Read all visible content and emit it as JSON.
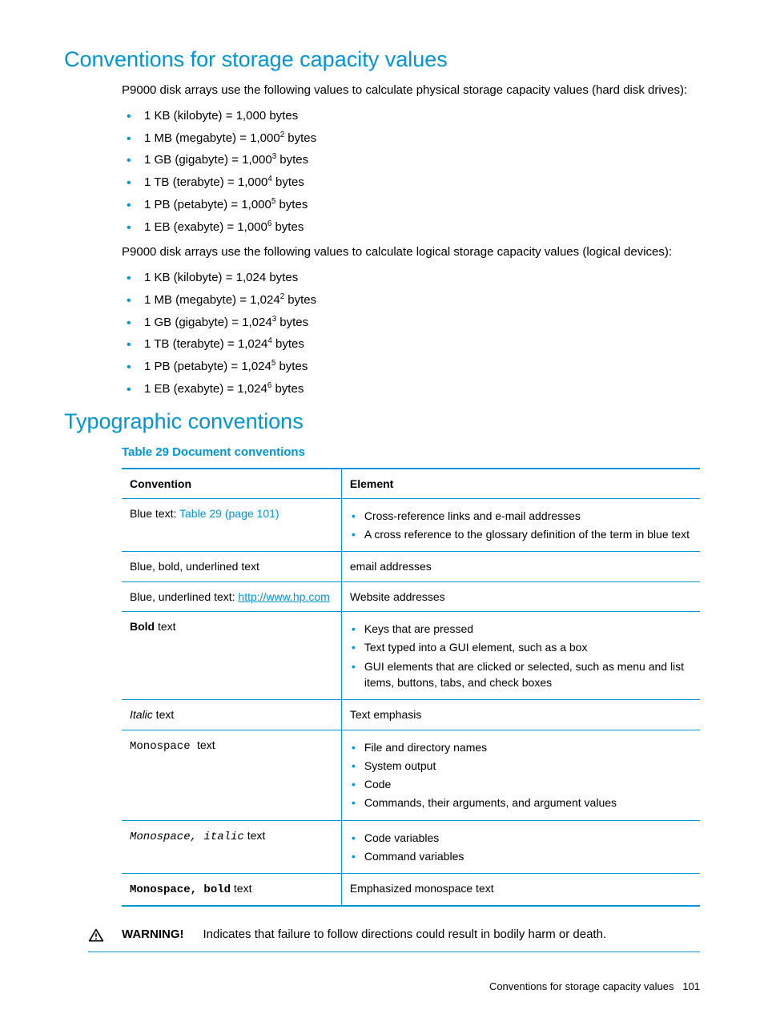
{
  "sections": {
    "storage": {
      "title": "Conventions for storage capacity values",
      "intro_physical": "P9000 disk arrays use the following values to calculate physical storage capacity values (hard disk drives):",
      "physical": [
        {
          "text": "1 KB (kilobyte) = 1,000 bytes",
          "exp": ""
        },
        {
          "text": "1 MB (megabyte) = 1,000",
          "exp": "2",
          "suffix": " bytes"
        },
        {
          "text": "1 GB (gigabyte) = 1,000",
          "exp": "3",
          "suffix": " bytes"
        },
        {
          "text": "1 TB (terabyte) = 1,000",
          "exp": "4",
          "suffix": " bytes"
        },
        {
          "text": "1 PB (petabyte) = 1,000",
          "exp": "5",
          "suffix": " bytes"
        },
        {
          "text": "1 EB (exabyte) = 1,000",
          "exp": "6",
          "suffix": " bytes"
        }
      ],
      "intro_logical": "P9000 disk arrays use the following values to calculate logical storage capacity values (logical devices):",
      "logical": [
        {
          "text": "1 KB (kilobyte) = 1,024 bytes",
          "exp": ""
        },
        {
          "text": "1 MB (megabyte) = 1,024",
          "exp": "2",
          "suffix": " bytes"
        },
        {
          "text": "1 GB (gigabyte) = 1,024",
          "exp": "3",
          "suffix": " bytes"
        },
        {
          "text": "1 TB (terabyte) = 1,024",
          "exp": "4",
          "suffix": " bytes"
        },
        {
          "text": "1 PB (petabyte) = 1,024",
          "exp": "5",
          "suffix": " bytes"
        },
        {
          "text": "1 EB (exabyte) = 1,024",
          "exp": "6",
          "suffix": " bytes"
        }
      ]
    },
    "typo": {
      "title": "Typographic conventions",
      "table_caption": "Table 29 Document conventions",
      "headers": {
        "c1": "Convention",
        "c2": "Element"
      },
      "rows": {
        "r1": {
          "conv_prefix": "Blue text: ",
          "conv_link": "Table 29 (page 101)",
          "elems": [
            "Cross-reference links and e-mail addresses",
            "A cross reference to the glossary definition of the term in blue text"
          ]
        },
        "r2": {
          "conv": "Blue, bold, underlined text",
          "elem": "email addresses"
        },
        "r3": {
          "conv_prefix": "Blue, underlined text: ",
          "conv_link": "http://www.hp.com",
          "elem": "Website addresses"
        },
        "r4": {
          "conv_bold": "Bold",
          "conv_rest": " text",
          "elems": [
            "Keys that are pressed",
            "Text typed into a GUI element, such as a box",
            "GUI elements that are clicked or selected, such as menu and list items, buttons, tabs, and check boxes"
          ]
        },
        "r5": {
          "conv_italic": "Italic",
          "conv_rest": "  text",
          "elem": "Text emphasis"
        },
        "r6": {
          "conv_mono": "Monospace ",
          "conv_rest": " text",
          "elems": [
            "File and directory names",
            "System output",
            "Code",
            "Commands, their arguments, and argument values"
          ]
        },
        "r7": {
          "conv_mono_italic": "Monospace, italic",
          "conv_rest": "  text",
          "elems": [
            "Code variables",
            "Command variables"
          ]
        },
        "r8": {
          "conv_mono_bold": "Monospace, bold",
          "conv_rest": "  text",
          "elem": "Emphasized monospace text"
        }
      }
    }
  },
  "warning": {
    "label": "WARNING!",
    "text": "Indicates that failure to follow directions could result in bodily harm or death."
  },
  "footer": {
    "text": "Conventions for storage capacity values",
    "page": "101"
  }
}
